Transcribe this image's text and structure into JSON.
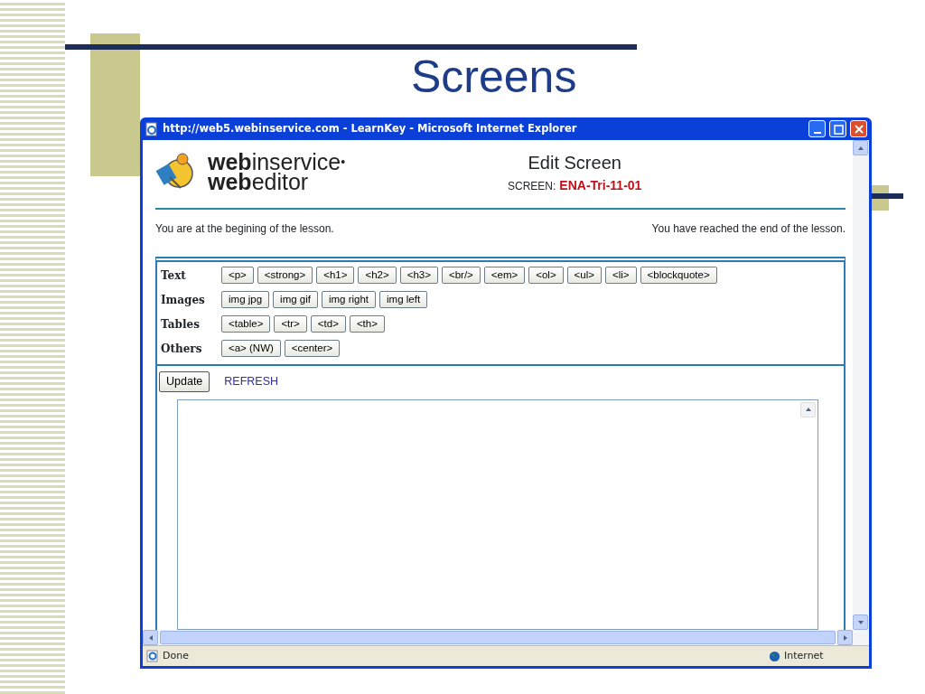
{
  "slide": {
    "title": "Screens"
  },
  "window": {
    "title": "http://web5.webinservice.com - LearnKey - Microsoft Internet Explorer"
  },
  "page": {
    "logo_line_1": "**web**inservice",
    "logo_mark": "•",
    "logo_line_2": "**web**editor",
    "heading": "Edit Screen",
    "screen_label": "SCREEN:",
    "screen_id": "ENA-Tri-11-01",
    "nav_start": "You are at the begining of the lesson.",
    "nav_end": "You have reached the end of the lesson.",
    "toolbar": [
      {
        "label": "Text",
        "buttons": [
          "<p>",
          "<strong>",
          "<h1>",
          "<h2>",
          "<h3>",
          "<br/>",
          "<em>",
          "<ol>",
          "<ul>",
          "<li>",
          "<blockquote>"
        ]
      },
      {
        "label": "Images",
        "buttons": [
          "img jpg",
          "img gif",
          "img right",
          "img left"
        ]
      },
      {
        "label": "Tables",
        "buttons": [
          "<table>",
          "<tr>",
          "<td>",
          "<th>"
        ]
      },
      {
        "label": "Others",
        "buttons": [
          "<a> (NW)",
          "<center>"
        ]
      }
    ],
    "update_button": "Update",
    "refresh_link": "REFRESH"
  },
  "status_bar": {
    "text": "Done",
    "zone": "Internet"
  }
}
